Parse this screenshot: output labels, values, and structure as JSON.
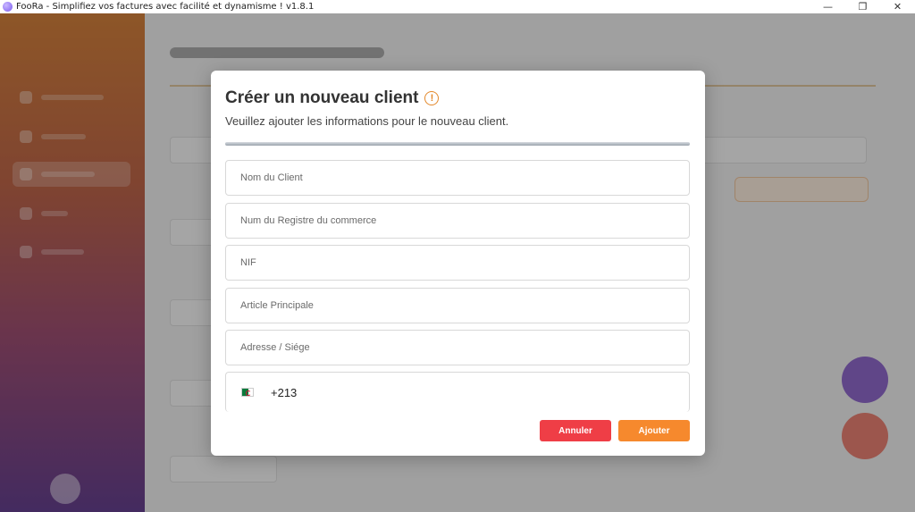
{
  "window": {
    "title": "FooRa - Simplifiez vos factures avec facilité et dynamisme ! v1.8.1",
    "minimize": "—",
    "maximize": "❐",
    "close": "✕"
  },
  "modal": {
    "title": "Créer un nouveau client",
    "warning_glyph": "!",
    "subtitle": "Veuillez ajouter les informations pour le nouveau client.",
    "fields": [
      {
        "placeholder": "Nom du Client",
        "value": ""
      },
      {
        "placeholder": "Num du Registre du commerce",
        "value": ""
      },
      {
        "placeholder": "NIF",
        "value": ""
      },
      {
        "placeholder": "Article Principale",
        "value": ""
      },
      {
        "placeholder": "Adresse / Siége",
        "value": ""
      }
    ],
    "phone": {
      "country_code": "+213",
      "value": ""
    },
    "buttons": {
      "cancel": "Annuler",
      "submit": "Ajouter"
    }
  },
  "colors": {
    "accent": "#f6892d",
    "danger": "#ef3e46",
    "warning": "#e3882a"
  },
  "icons": {
    "app": "app-logo-icon",
    "warning": "exclamation-circle-icon",
    "flag": "algeria-flag-icon"
  }
}
